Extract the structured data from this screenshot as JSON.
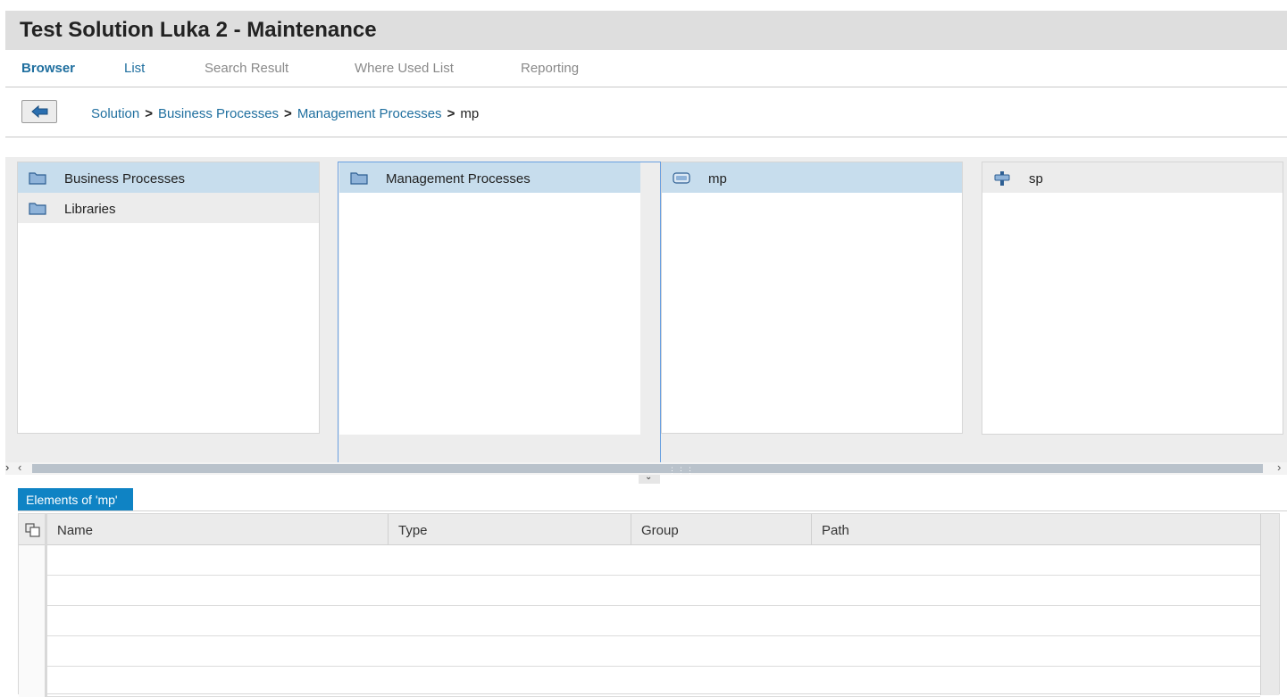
{
  "title": "Test Solution Luka 2 - Maintenance",
  "tabs": [
    {
      "label": "Browser"
    },
    {
      "label": "List"
    },
    {
      "label": "Search Result"
    },
    {
      "label": "Where Used List"
    },
    {
      "label": "Reporting"
    }
  ],
  "breadcrumb": {
    "items": [
      "Solution",
      "Business Processes",
      "Management Processes"
    ],
    "separator": ">",
    "current": "mp"
  },
  "columns": [
    {
      "items": [
        {
          "label": "Business Processes",
          "icon": "folder-icon",
          "selected": true
        },
        {
          "label": "Libraries",
          "icon": "folder-icon",
          "selected": false
        }
      ]
    },
    {
      "items": [
        {
          "label": "Management Processes",
          "icon": "folder-icon",
          "selected": true
        }
      ]
    },
    {
      "items": [
        {
          "label": "mp",
          "icon": "process-icon",
          "selected": true
        }
      ]
    },
    {
      "items": [
        {
          "label": "sp",
          "icon": "step-icon",
          "selected": false
        }
      ]
    }
  ],
  "elements_panel": {
    "tab_label": "Elements of 'mp'",
    "headers": [
      "Name",
      "Type",
      "Group",
      "Path"
    ],
    "rows": []
  },
  "colors": {
    "accent": "#0f83c4",
    "link": "#1f6f9f",
    "selection": "#c7dded"
  }
}
